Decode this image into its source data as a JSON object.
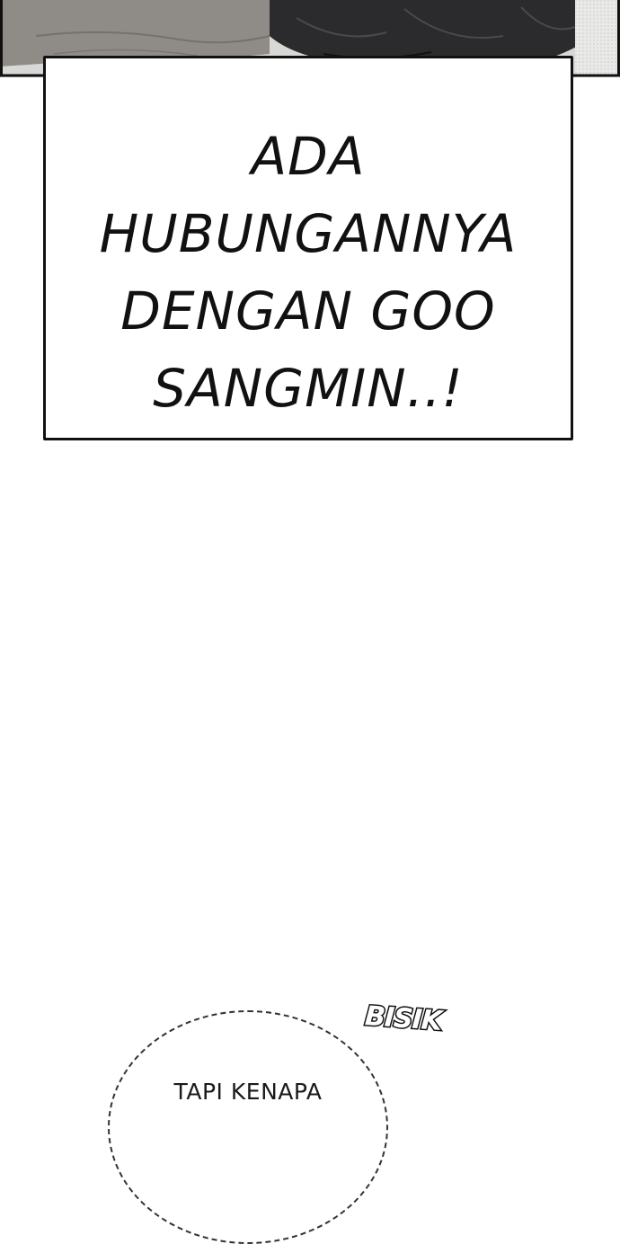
{
  "caption": {
    "text": "ADA\nHUBUNGANNYA\nDENGAN GOO\nSANGMIN..!"
  },
  "sfx": {
    "text": "BISIK"
  },
  "whisper_bubble": {
    "text": "TAPI KENAPA"
  },
  "colors": {
    "background": "#ffffff",
    "ink": "#111111",
    "panel_gray": "#8d8b87"
  }
}
